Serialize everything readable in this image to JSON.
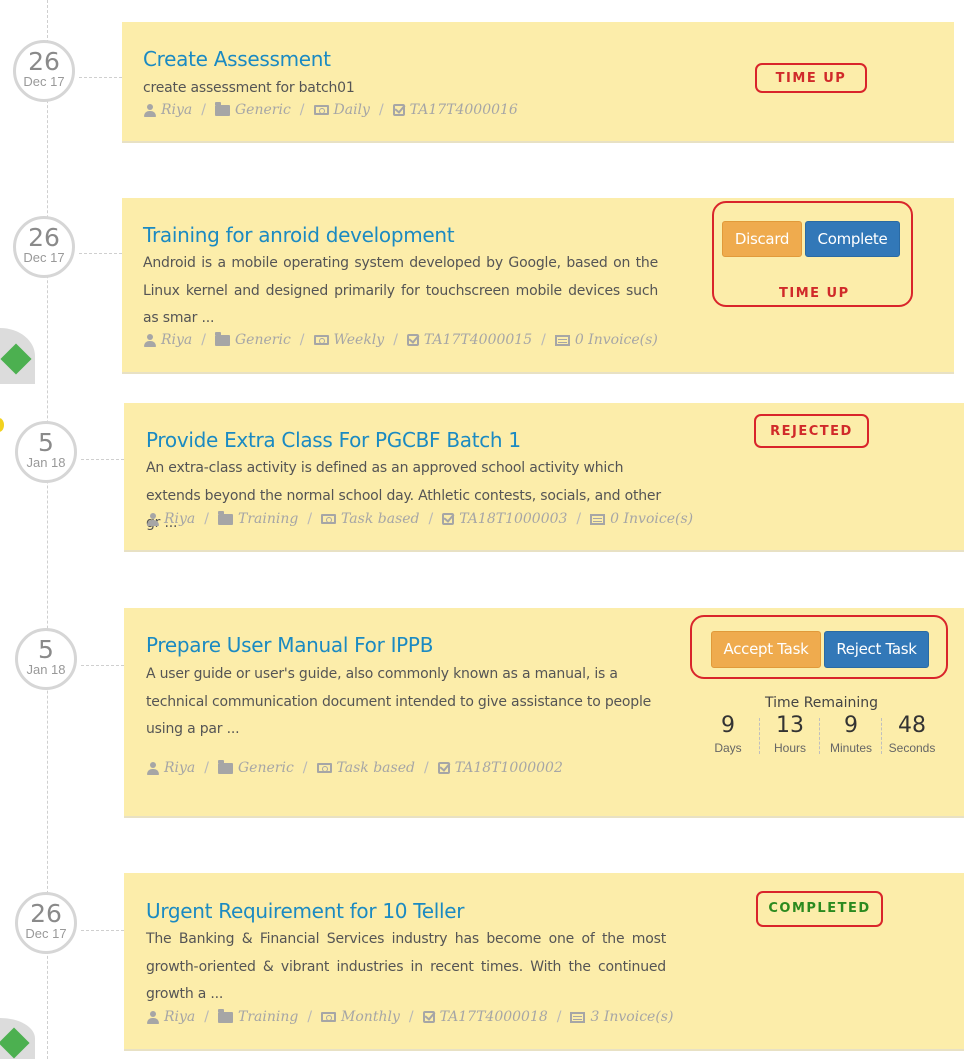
{
  "tasks": [
    {
      "day": "26",
      "month": "Dec 17",
      "title": "Create Assessment",
      "description": "create assessment for batch01",
      "meta": {
        "user": "Riya",
        "category": "Generic",
        "frequency": "Daily",
        "task_id": "TA17T4000016"
      },
      "status": "TIME UP"
    },
    {
      "day": "26",
      "month": "Dec 17",
      "title": "Training for anroid development",
      "description": "Android is a mobile operating system developed by Google, based on the Linux kernel and designed primarily for touchscreen mobile devices such as smar ...",
      "meta": {
        "user": "Riya",
        "category": "Generic",
        "frequency": "Weekly",
        "task_id": "TA17T4000015",
        "invoices": "0 Invoice(s)"
      },
      "buttons": {
        "discard": "Discard",
        "complete": "Complete"
      },
      "status": "TIME UP"
    },
    {
      "day": "5",
      "month": "Jan 18",
      "title": "Provide Extra Class For PGCBF Batch 1",
      "description": "An extra-class activity is defined as an approved school activity which extends beyond the normal school day. Athletic contests, socials, and other gr ...",
      "meta": {
        "user": "Riya",
        "category": "Training",
        "frequency": "Task based",
        "task_id": "TA18T1000003",
        "invoices": "0 Invoice(s)"
      },
      "status": "REJECTED"
    },
    {
      "day": "5",
      "month": "Jan 18",
      "title": "Prepare User Manual For IPPB",
      "description": "A user guide or user's guide, also commonly known as a manual, is a technical communication document intended to give assistance to people using a par ...",
      "meta": {
        "user": "Riya",
        "category": "Generic",
        "frequency": "Task based",
        "task_id": "TA18T1000002"
      },
      "buttons": {
        "accept": "Accept Task",
        "reject": "Reject Task"
      },
      "timer": {
        "label": "Time Remaining",
        "days": "9",
        "days_label": "Days",
        "hours": "13",
        "hours_label": "Hours",
        "minutes": "9",
        "minutes_label": "Minutes",
        "seconds": "48",
        "seconds_label": "Seconds"
      }
    },
    {
      "day": "26",
      "month": "Dec 17",
      "title": "Urgent Requirement for 10 Teller",
      "description": "The Banking & Financial Services industry has become one of the most growth-oriented & vibrant industries in recent times. With the continued growth a ...",
      "meta": {
        "user": "Riya",
        "category": "Training",
        "frequency": "Monthly",
        "task_id": "TA17T4000018",
        "invoices": "3 Invoice(s)"
      },
      "status": "COMPLETED"
    }
  ],
  "colors": {
    "card_bg": "#fcedaa",
    "title": "#1b8ac2",
    "alert_red": "#d9252b",
    "success_green": "#2b8a1f",
    "btn_orange": "#efab4e",
    "btn_blue": "#3278b8"
  }
}
